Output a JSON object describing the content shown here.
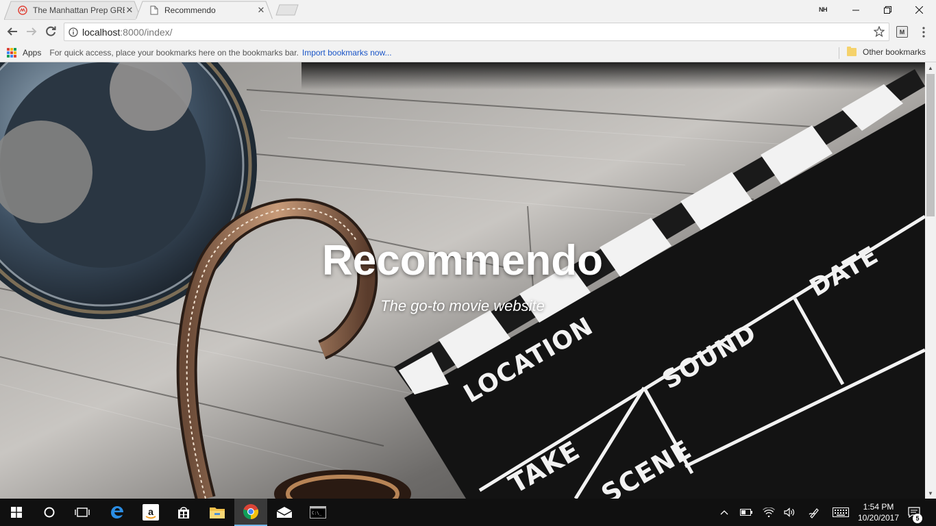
{
  "browser": {
    "tabs": [
      {
        "title": "The Manhattan Prep GRE",
        "favicon": "manhattan-prep-icon",
        "active": false
      },
      {
        "title": "Recommendo",
        "favicon": "page-icon",
        "active": true
      }
    ],
    "profile_label": "NH",
    "window_controls": [
      "minimize-icon",
      "maximize-icon",
      "close-icon"
    ],
    "url": {
      "host": "localhost",
      "path": ":8000/index/"
    },
    "extension_label": "M"
  },
  "bookmarks_bar": {
    "apps_label": "Apps",
    "hint": "For quick access, place your bookmarks here on the bookmarks bar.",
    "import_link": "Import bookmarks now...",
    "other_label": "Other bookmarks"
  },
  "page": {
    "hero_title": "Recommendo",
    "hero_subtitle": "The go-to movie website",
    "slate_labels": {
      "location": "LOCATION",
      "sound": "SOUND",
      "date": "DATE",
      "take": "TAKE",
      "scene": "SCENE"
    }
  },
  "taskbar": {
    "apps": [
      "windows-start-icon",
      "cortana-icon",
      "task-view-icon",
      "edge-icon",
      "amazon-icon",
      "store-icon",
      "file-explorer-icon",
      "chrome-icon",
      "mail-icon",
      "terminal-icon"
    ],
    "time": "1:54 PM",
    "date": "10/20/2017",
    "notification_count": "5"
  },
  "colors": {
    "chrome_bg": "#f2f2f2",
    "link": "#1a55c7",
    "taskbar": "#101010",
    "accent": "#76b9ed"
  }
}
